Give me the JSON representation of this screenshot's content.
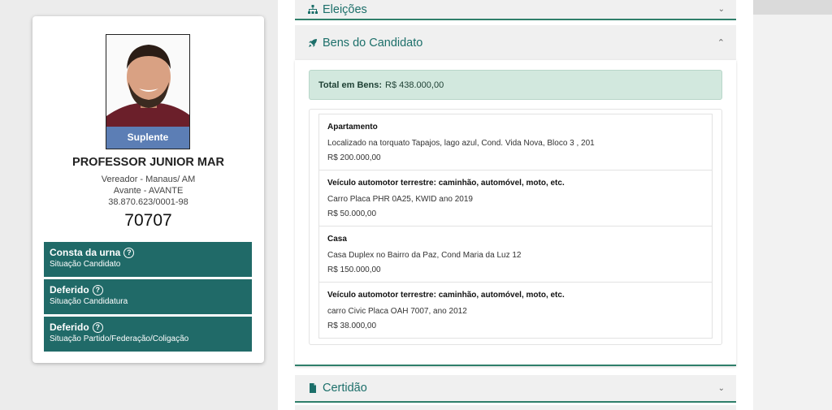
{
  "candidate": {
    "badge": "Suplente",
    "name": "PROFESSOR JUNIOR MAR",
    "office": "Vereador - Manaus/ AM",
    "party": "Avante - AVANTE",
    "cnpj": "38.870.623/0001-98",
    "number": "70707",
    "status": [
      {
        "title": "Consta da urna",
        "subtitle": "Situação Candidato"
      },
      {
        "title": "Deferido",
        "subtitle": "Situação Candidatura"
      },
      {
        "title": "Deferido",
        "subtitle": "Situação Partido/Federação/Coligação"
      }
    ]
  },
  "accordion": {
    "eleicoes": "Eleições",
    "bens": "Bens do Candidato",
    "certidao": "Certidão"
  },
  "bens": {
    "total_label": "Total em Bens:",
    "total_value": "R$ 438.000,00",
    "items": [
      {
        "title": "Apartamento",
        "description": "Localizado na torquato Tapajos, lago azul, Cond. Vida Nova, Bloco 3 , 201",
        "value": "R$ 200.000,00"
      },
      {
        "title": "Veículo automotor terrestre: caminhão, automóvel, moto, etc.",
        "description": "Carro Placa PHR 0A25, KWID ano 2019",
        "value": "R$ 50.000,00"
      },
      {
        "title": "Casa",
        "description": "Casa Duplex no Bairro da Paz, Cond Maria da Luz 12",
        "value": "R$ 150.000,00"
      },
      {
        "title": "Veículo automotor terrestre: caminhão, automóvel, moto, etc.",
        "description": "carro Civic Placa OAH 7007, ano 2012",
        "value": "R$ 38.000,00"
      }
    ]
  },
  "colors": {
    "accent": "#206a68",
    "header_text": "#1c6f6a",
    "total_bg": "#d2e8de",
    "badge": "#5a8cc8"
  },
  "icons": {
    "eleicoes": "sitemap-icon",
    "bens": "rocket-icon",
    "certidao": "file-icon",
    "status": "question-circle-icon"
  }
}
